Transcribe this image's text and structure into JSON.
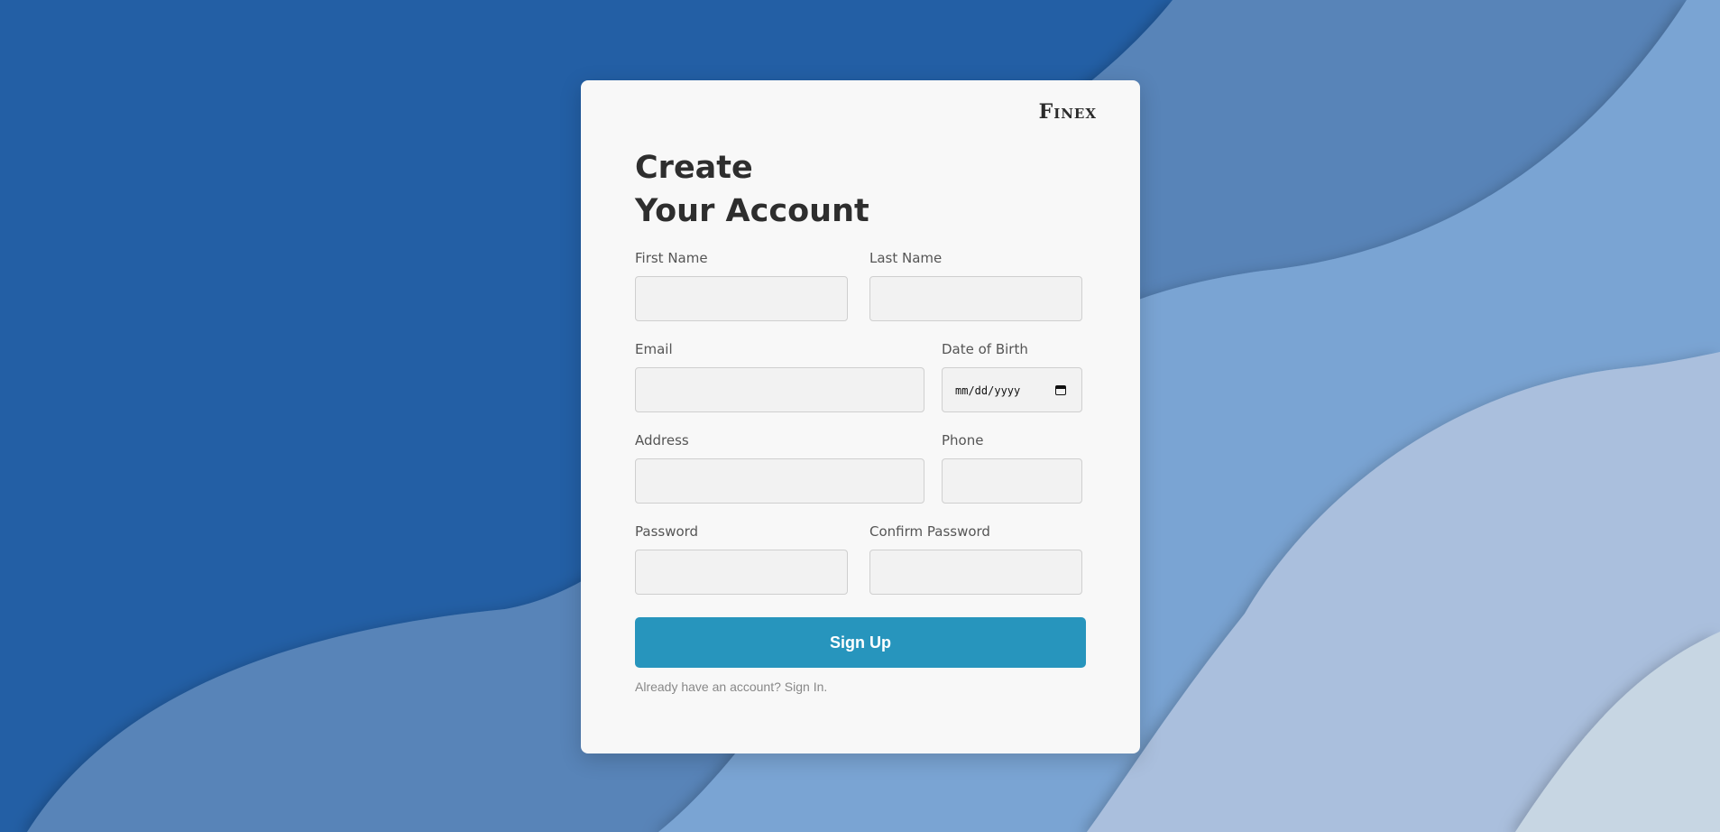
{
  "colors": {
    "background_dark": "#235fa5",
    "background_mid": "#5884b8",
    "background_light": "#7aa4d3",
    "background_pale": "#aabfdd",
    "background_lightest": "#c7d6e3",
    "card": "#f8f8f8",
    "button": "#2795bd",
    "input_bg": "#f2f2f2"
  },
  "brand": "Finex",
  "title": {
    "line1": "Create",
    "line2": "Your Account"
  },
  "form": {
    "first_name": {
      "label": "First Name",
      "value": ""
    },
    "last_name": {
      "label": "Last Name",
      "value": ""
    },
    "email": {
      "label": "Email",
      "value": ""
    },
    "dob": {
      "label": "Date of Birth",
      "placeholder": "mm/dd/yyyy",
      "icon": "calendar-icon"
    },
    "address": {
      "label": "Address",
      "value": ""
    },
    "phone": {
      "label": "Phone",
      "value": ""
    },
    "password": {
      "label": "Password",
      "value": ""
    },
    "confirm_password": {
      "label": "Confirm Password",
      "value": ""
    }
  },
  "signup_button": "Sign Up",
  "footer": {
    "prompt": "Already have an account?",
    "link": "Sign In."
  }
}
